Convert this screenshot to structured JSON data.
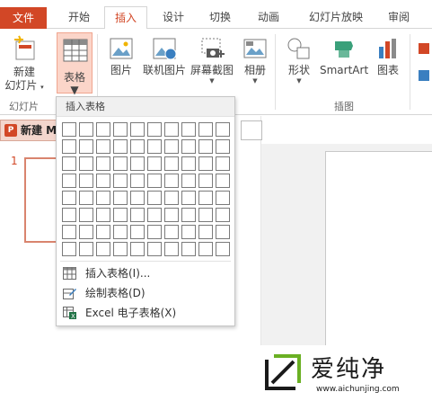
{
  "tabs": {
    "file": "文件",
    "home": "开始",
    "insert": "插入",
    "design": "设计",
    "transitions": "切换",
    "animations": "动画",
    "slideshow": "幻灯片放映",
    "review": "审阅"
  },
  "ribbon": {
    "new_slide_line1": "新建",
    "new_slide_line2": "幻灯片",
    "table": "表格",
    "picture": "图片",
    "online_picture": "联机图片",
    "screenshot": "屏幕截图",
    "album": "相册",
    "shapes": "形状",
    "smartart": "SmartArt",
    "chart": "图表",
    "group_slides": "幻灯片",
    "group_illustrations": "插图"
  },
  "left": {
    "section_title": "新建 M",
    "slide_number": "1"
  },
  "dropdown": {
    "header": "插入表格",
    "grid_cols": 10,
    "grid_rows": 8,
    "items": [
      {
        "label": "插入表格(I)...",
        "icon": "table-icon"
      },
      {
        "label": "绘制表格(D)",
        "icon": "pencil-table-icon"
      },
      {
        "label": "Excel 电子表格(X)",
        "icon": "excel-table-icon"
      }
    ]
  },
  "watermark": {
    "brand": "爱纯净",
    "url": "www.aichunjing.com"
  },
  "colors": {
    "accent": "#d24726",
    "table_button_bg": "#fbd5c9"
  }
}
